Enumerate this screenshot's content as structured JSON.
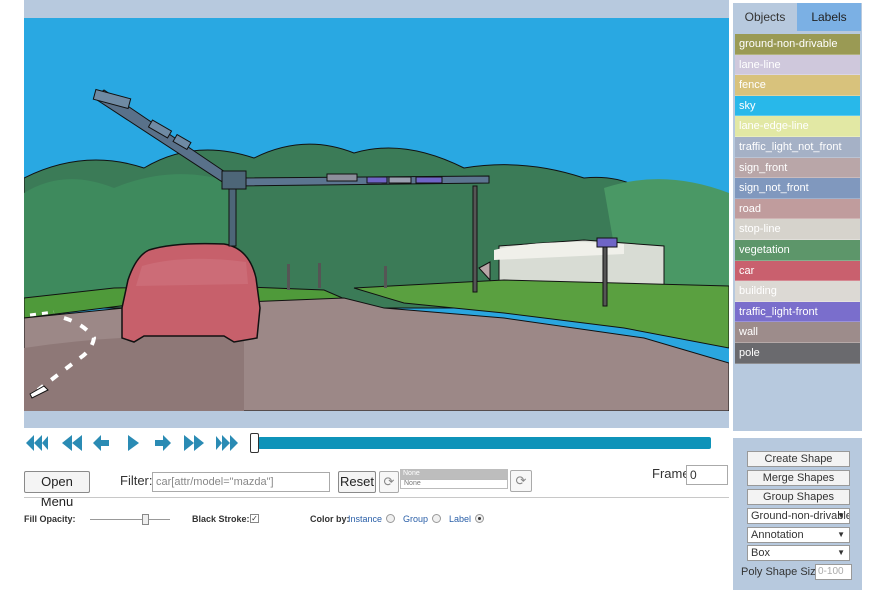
{
  "player": {
    "buttons": [
      "first-frame",
      "prev-multiple",
      "prev-frame",
      "play",
      "next-frame",
      "next-multiple",
      "last-frame"
    ]
  },
  "toolbar": {
    "open_menu": "Open Menu",
    "filter_label": "Filter:",
    "filter_value": "car[attr/model=\"mazda\"]",
    "reset": "Reset",
    "mini_a": "None",
    "mini_b": "None",
    "frame_label": "Frame",
    "frame_value": "0"
  },
  "options": {
    "fill_opacity": "Fill Opacity:",
    "black_stroke": "Black Stroke:",
    "black_stroke_checked": "✓",
    "color_by": "Color by:",
    "instance": "Instance",
    "group": "Group",
    "label": "Label",
    "selected": "label",
    "fill_opacity_level": 0.7
  },
  "right_panel": {
    "tabs": [
      "Objects",
      "Labels"
    ],
    "selected_tab": "Labels",
    "labels": [
      {
        "name": "ground-non-drivable",
        "color": "#9a9a54"
      },
      {
        "name": "lane-line",
        "color": "#cfc8dc"
      },
      {
        "name": "fence",
        "color": "#d8c27c"
      },
      {
        "name": "sky",
        "color": "#28b8ea"
      },
      {
        "name": "lane-edge-line",
        "color": "#e2e8a4"
      },
      {
        "name": "traffic_light_not_front",
        "color": "#a5b1c6"
      },
      {
        "name": "sign_front",
        "color": "#b9a6a8"
      },
      {
        "name": "sign_not_front",
        "color": "#8098be"
      },
      {
        "name": "road",
        "color": "#c09c9d"
      },
      {
        "name": "stop-line",
        "color": "#d6d3cc"
      },
      {
        "name": "vegetation",
        "color": "#5d966a"
      },
      {
        "name": "car",
        "color": "#c9606e"
      },
      {
        "name": "building",
        "color": "#dcd9d4"
      },
      {
        "name": "traffic_light-front",
        "color": "#7a6ecc"
      },
      {
        "name": "wall",
        "color": "#9d8c8b"
      },
      {
        "name": "pole",
        "color": "#6a6a6e"
      }
    ]
  },
  "create_panel": {
    "create_shape": "Create Shape",
    "merge_shapes": "Merge Shapes",
    "group_shapes": "Group Shapes",
    "select_label": "Ground-non-drivable",
    "select_mode": "Annotation",
    "select_type": "Box",
    "poly_size_label": "Poly Shape Size:",
    "poly_size_placeholder": "0-100"
  }
}
